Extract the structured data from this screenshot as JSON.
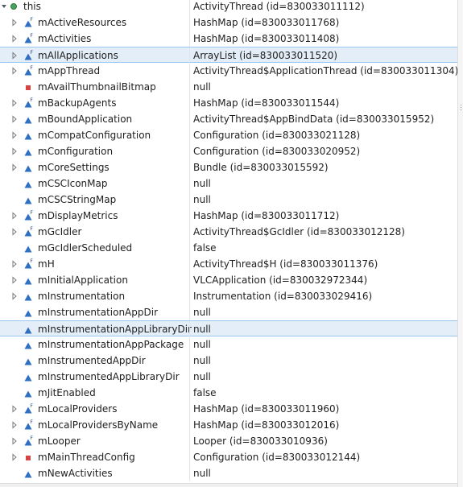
{
  "variables": {
    "root": {
      "name": "this",
      "value": "ActivityThread  (id=830033011112)"
    },
    "rows": [
      {
        "name": "mActiveResources",
        "value": "HashMap  (id=830033011768)",
        "expandable": true,
        "icon": "field-final-icon"
      },
      {
        "name": "mActivities",
        "value": "HashMap  (id=830033011408)",
        "expandable": true,
        "icon": "field-final-icon"
      },
      {
        "name": "mAllApplications",
        "value": "ArrayList  (id=830033011520)",
        "expandable": true,
        "icon": "field-final-icon",
        "selected": true
      },
      {
        "name": "mAppThread",
        "value": "ActivityThread$ApplicationThread  (id=830033011304)",
        "expandable": true,
        "icon": "field-final-icon"
      },
      {
        "name": "mAvailThumbnailBitmap",
        "value": "null",
        "expandable": false,
        "icon": "field-private-icon"
      },
      {
        "name": "mBackupAgents",
        "value": "HashMap  (id=830033011544)",
        "expandable": true,
        "icon": "field-final-icon"
      },
      {
        "name": "mBoundApplication",
        "value": "ActivityThread$AppBindData  (id=830033015952)",
        "expandable": true,
        "icon": "field-icon"
      },
      {
        "name": "mCompatConfiguration",
        "value": "Configuration  (id=830033021128)",
        "expandable": true,
        "icon": "field-icon"
      },
      {
        "name": "mConfiguration",
        "value": "Configuration  (id=830033020952)",
        "expandable": true,
        "icon": "field-icon"
      },
      {
        "name": "mCoreSettings",
        "value": "Bundle  (id=830033015592)",
        "expandable": true,
        "icon": "field-icon"
      },
      {
        "name": "mCSCIconMap",
        "value": "null",
        "expandable": false,
        "icon": "field-icon"
      },
      {
        "name": "mCSCStringMap",
        "value": "null",
        "expandable": false,
        "icon": "field-icon"
      },
      {
        "name": "mDisplayMetrics",
        "value": "HashMap  (id=830033011712)",
        "expandable": true,
        "icon": "field-final-icon"
      },
      {
        "name": "mGcIdler",
        "value": "ActivityThread$GcIdler  (id=830033012128)",
        "expandable": true,
        "icon": "field-final-icon"
      },
      {
        "name": "mGcIdlerScheduled",
        "value": "false",
        "expandable": false,
        "icon": "field-icon"
      },
      {
        "name": "mH",
        "value": "ActivityThread$H  (id=830033011376)",
        "expandable": true,
        "icon": "field-final-icon"
      },
      {
        "name": "mInitialApplication",
        "value": "VLCApplication  (id=830032972344)",
        "expandable": true,
        "icon": "field-icon"
      },
      {
        "name": "mInstrumentation",
        "value": "Instrumentation  (id=830033029416)",
        "expandable": true,
        "icon": "field-icon"
      },
      {
        "name": "mInstrumentationAppDir",
        "value": "null",
        "expandable": false,
        "icon": "field-icon"
      },
      {
        "name": "mInstrumentationAppLibraryDir",
        "value": "null",
        "expandable": false,
        "icon": "field-icon",
        "selected": true
      },
      {
        "name": "mInstrumentationAppPackage",
        "value": "null",
        "expandable": false,
        "icon": "field-icon"
      },
      {
        "name": "mInstrumentedAppDir",
        "value": "null",
        "expandable": false,
        "icon": "field-icon"
      },
      {
        "name": "mInstrumentedAppLibraryDir",
        "value": "null",
        "expandable": false,
        "icon": "field-icon"
      },
      {
        "name": "mJitEnabled",
        "value": "false",
        "expandable": false,
        "icon": "field-icon"
      },
      {
        "name": "mLocalProviders",
        "value": "HashMap  (id=830033011960)",
        "expandable": true,
        "icon": "field-final-icon"
      },
      {
        "name": "mLocalProvidersByName",
        "value": "HashMap  (id=830033012016)",
        "expandable": true,
        "icon": "field-final-icon"
      },
      {
        "name": "mLooper",
        "value": "Looper  (id=830033010936)",
        "expandable": true,
        "icon": "field-final-icon"
      },
      {
        "name": "mMainThreadConfig",
        "value": "Configuration  (id=830033012144)",
        "expandable": true,
        "icon": "field-private-icon"
      },
      {
        "name": "mNewActivities",
        "value": "null",
        "expandable": false,
        "icon": "field-icon"
      }
    ]
  },
  "colors": {
    "field_icon": "#2f6fc1",
    "private_icon": "#d64545",
    "selection": "#e3eef9",
    "root_dot": "#4aa05c"
  }
}
